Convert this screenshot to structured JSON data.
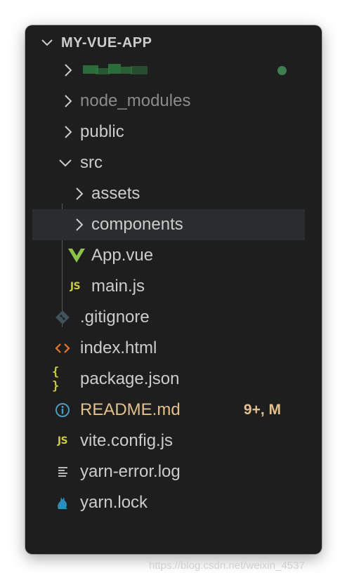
{
  "explorer": {
    "title": "MY-VUE-APP",
    "items": [
      {
        "label": "",
        "type": "folder",
        "expanded": false,
        "icon": "chevron-right-icon",
        "note": "redacted"
      },
      {
        "label": "node_modules",
        "type": "folder",
        "expanded": false,
        "icon": "chevron-right-icon"
      },
      {
        "label": "public",
        "type": "folder",
        "expanded": false,
        "icon": "chevron-right-icon"
      },
      {
        "label": "src",
        "type": "folder",
        "expanded": true,
        "icon": "chevron-down-icon"
      },
      {
        "label": "assets",
        "type": "folder",
        "expanded": false,
        "icon": "chevron-right-icon"
      },
      {
        "label": "components",
        "type": "folder",
        "expanded": false,
        "icon": "chevron-right-icon",
        "selected": true
      },
      {
        "label": "App.vue",
        "type": "file",
        "icon": "vue-icon"
      },
      {
        "label": "main.js",
        "type": "file",
        "icon": "js-icon",
        "icon_text": "JS"
      },
      {
        "label": ".gitignore",
        "type": "file",
        "icon": "git-icon"
      },
      {
        "label": "index.html",
        "type": "file",
        "icon": "html-icon"
      },
      {
        "label": "package.json",
        "type": "file",
        "icon": "json-icon",
        "icon_text": "{ }"
      },
      {
        "label": "README.md",
        "type": "file",
        "icon": "info-icon",
        "badge": "9+, M"
      },
      {
        "label": "vite.config.js",
        "type": "file",
        "icon": "js-icon",
        "icon_text": "JS"
      },
      {
        "label": "yarn-error.log",
        "type": "file",
        "icon": "log-icon"
      },
      {
        "label": "yarn.lock",
        "type": "file",
        "icon": "yarn-icon"
      }
    ]
  },
  "watermark": "https://blog.csdn.net/weixin_4537",
  "colors": {
    "background": "#1e1e1e",
    "text": "#cccccc",
    "dim_text": "#8b8b8b",
    "modified": "#e2c08d",
    "selected_row": "#2a2d2e",
    "vue": "#8dc149",
    "js": "#cbcb41",
    "html": "#e37933",
    "info": "#519aba",
    "git": "#41535b"
  }
}
